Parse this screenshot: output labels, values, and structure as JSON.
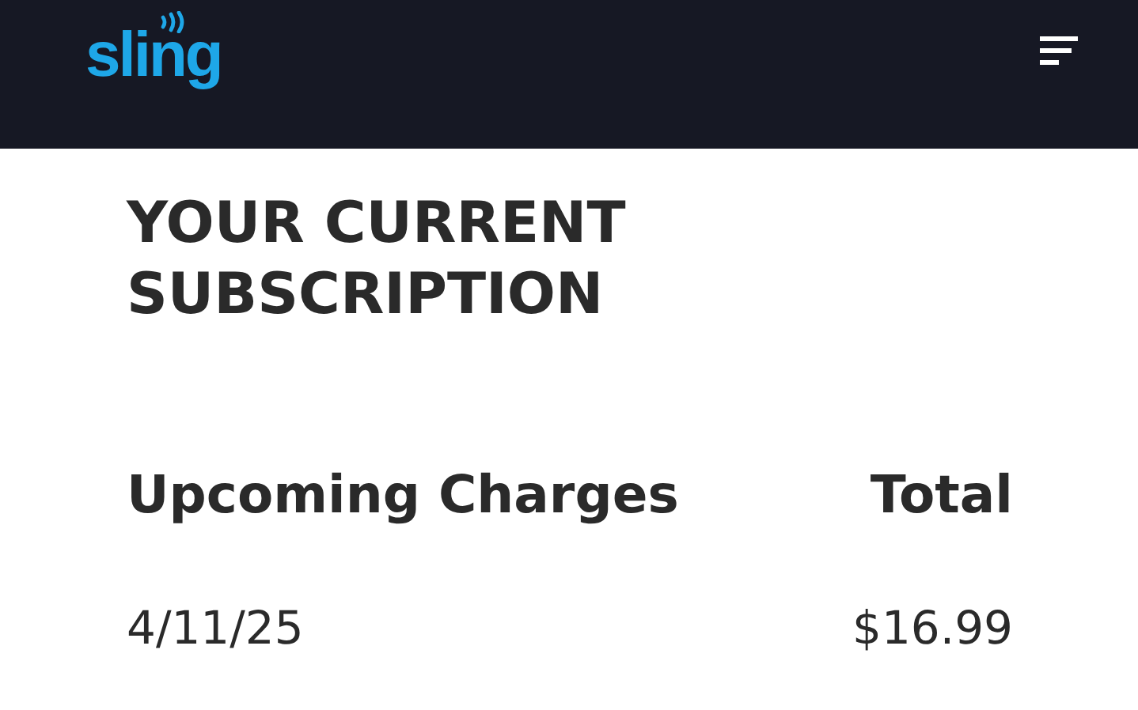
{
  "header": {
    "logo": "sling"
  },
  "title": "YOUR CURRENT SUBSCRIPTION",
  "charges": {
    "columns": [
      "Upcoming Charges",
      "Total"
    ],
    "rows": [
      {
        "date": "4/11/25",
        "total": "$16.99"
      }
    ]
  }
}
